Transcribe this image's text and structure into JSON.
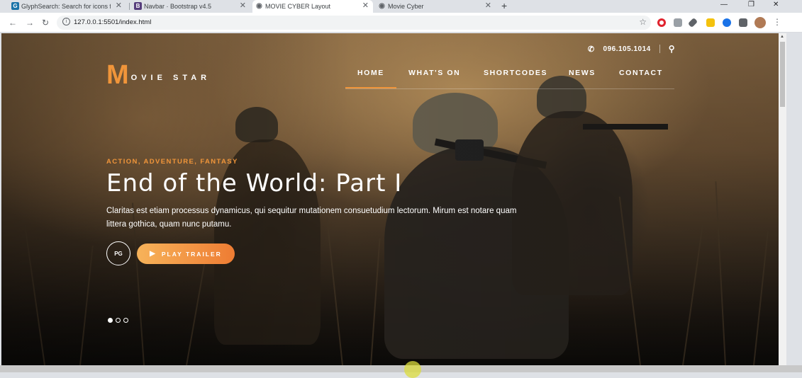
{
  "browser": {
    "tabs": [
      {
        "title": "GlyphSearch: Search for icons fro",
        "icon_letter": "G",
        "icon_color": "#1a73a8",
        "active": false
      },
      {
        "title": "Navbar · Bootstrap v4.5",
        "icon_letter": "B",
        "icon_color": "#563d7c",
        "active": false
      },
      {
        "title": "MOVIE CYBER Layout",
        "icon_letter": "◉",
        "icon_color": "#5f6368",
        "active": true
      },
      {
        "title": "Movie Cyber",
        "icon_letter": "◉",
        "icon_color": "#5f6368",
        "active": false
      }
    ],
    "new_tab_label": "+",
    "url": "127.0.0.1:5501/index.html",
    "extension_icons": [
      "opera-icon",
      "camera-icon",
      "eyedropper-icon",
      "yellow-ext-icon",
      "blue-ext-icon",
      "grid-ext-icon",
      "puzzle-icon",
      "profile-avatar"
    ]
  },
  "site": {
    "phone": "096.105.1014",
    "logo_letter": "M",
    "logo_text": "OVIE STAR",
    "accent_color": "#f0953a",
    "menu": [
      {
        "label": "HOME",
        "active": true
      },
      {
        "label": "WHAT'S ON",
        "active": false
      },
      {
        "label": "SHORTCODES",
        "active": false
      },
      {
        "label": "NEWS",
        "active": false
      },
      {
        "label": "CONTACT",
        "active": false
      }
    ],
    "hero": {
      "genre": "ACTION, ADVENTURE, FANTASY",
      "title": "End of the World: Part I",
      "description": "Claritas est etiam processus dynamicus, qui sequitur mutationem consuetudium lectorum. Mirum est notare quam littera gothica, quam nunc putamu.",
      "rating": "PG",
      "trailer_label": "PLAY TRAILER"
    },
    "slider": {
      "count": 3,
      "active_index": 0
    }
  }
}
